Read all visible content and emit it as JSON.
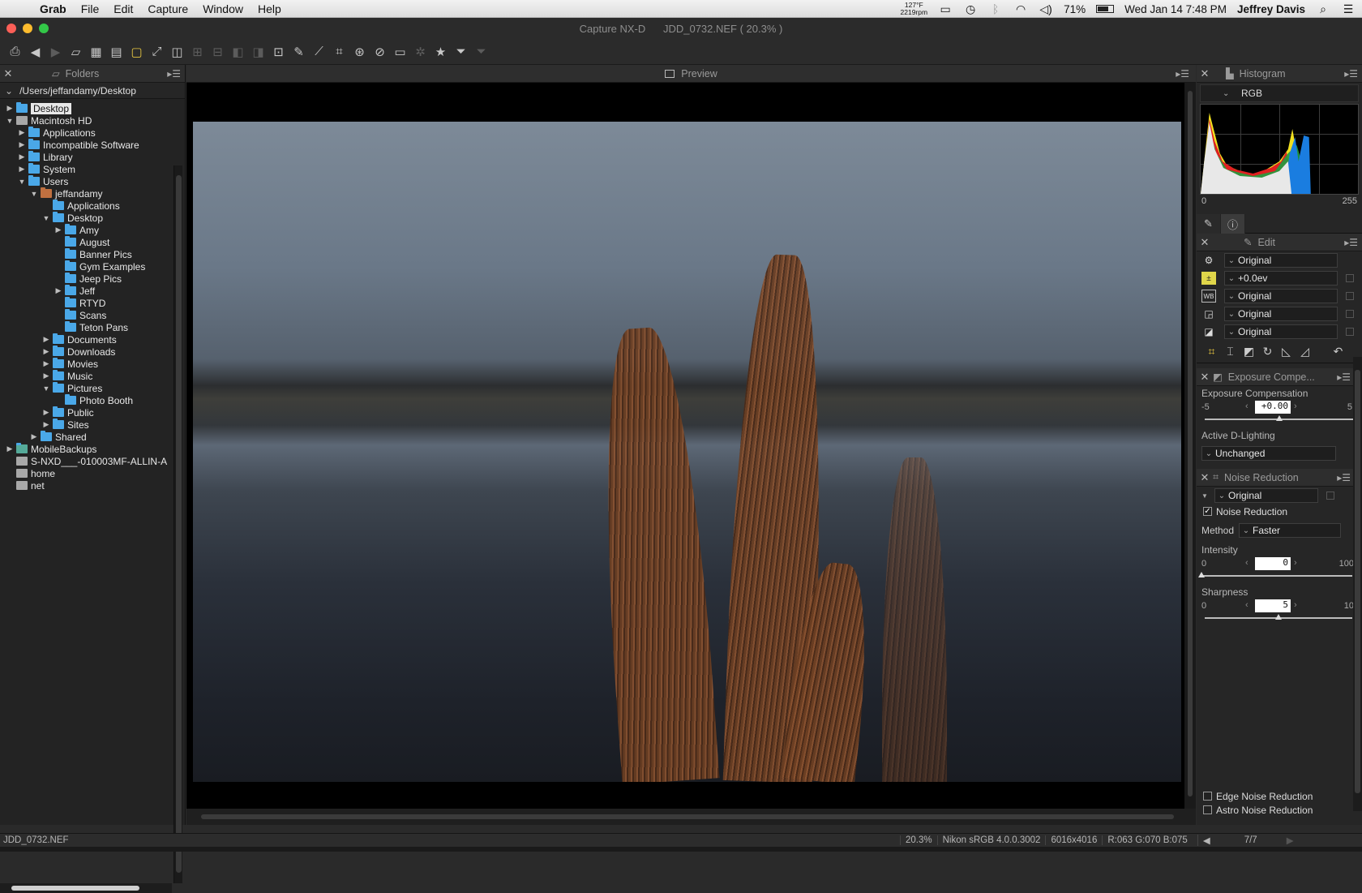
{
  "menubar": {
    "apple_icon": "apple-logo-icon",
    "app_name": "Grab",
    "items": [
      "File",
      "Edit",
      "Capture",
      "Window",
      "Help"
    ],
    "temp_line1": "127°F",
    "temp_line2": "2219rpm",
    "battery": "71%",
    "datetime": "Wed Jan 14  7:48 PM",
    "user": "Jeffrey Davis"
  },
  "window": {
    "app_title": "Capture NX-D",
    "file_title": "JDD_0732.NEF ( 20.3% )"
  },
  "folders_panel": {
    "title": "Folders",
    "path": "/Users/jeffandamy/Desktop",
    "tree": [
      {
        "label": "Desktop",
        "depth": 0,
        "tri": "▶",
        "kind": "folder",
        "selected": true
      },
      {
        "label": "Macintosh HD",
        "depth": 0,
        "tri": "▼",
        "kind": "disk"
      },
      {
        "label": "Applications",
        "depth": 1,
        "tri": "▶",
        "kind": "folder"
      },
      {
        "label": "Incompatible Software",
        "depth": 1,
        "tri": "▶",
        "kind": "folder"
      },
      {
        "label": "Library",
        "depth": 1,
        "tri": "▶",
        "kind": "folder"
      },
      {
        "label": "System",
        "depth": 1,
        "tri": "▶",
        "kind": "folder"
      },
      {
        "label": "Users",
        "depth": 1,
        "tri": "▼",
        "kind": "folder"
      },
      {
        "label": "jeffandamy",
        "depth": 2,
        "tri": "▼",
        "kind": "home"
      },
      {
        "label": "Applications",
        "depth": 3,
        "tri": "",
        "kind": "folder"
      },
      {
        "label": "Desktop",
        "depth": 3,
        "tri": "▼",
        "kind": "folder"
      },
      {
        "label": "Amy",
        "depth": 4,
        "tri": "▶",
        "kind": "folder"
      },
      {
        "label": "August",
        "depth": 4,
        "tri": "",
        "kind": "folder"
      },
      {
        "label": "Banner Pics",
        "depth": 4,
        "tri": "",
        "kind": "folder"
      },
      {
        "label": "Gym Examples",
        "depth": 4,
        "tri": "",
        "kind": "folder"
      },
      {
        "label": "Jeep Pics",
        "depth": 4,
        "tri": "",
        "kind": "folder"
      },
      {
        "label": "Jeff",
        "depth": 4,
        "tri": "▶",
        "kind": "folder"
      },
      {
        "label": "RTYD",
        "depth": 4,
        "tri": "",
        "kind": "folder"
      },
      {
        "label": "Scans",
        "depth": 4,
        "tri": "",
        "kind": "folder"
      },
      {
        "label": "Teton Pans",
        "depth": 4,
        "tri": "",
        "kind": "folder"
      },
      {
        "label": "Documents",
        "depth": 3,
        "tri": "▶",
        "kind": "folder"
      },
      {
        "label": "Downloads",
        "depth": 3,
        "tri": "▶",
        "kind": "folder"
      },
      {
        "label": "Movies",
        "depth": 3,
        "tri": "▶",
        "kind": "folder"
      },
      {
        "label": "Music",
        "depth": 3,
        "tri": "▶",
        "kind": "folder"
      },
      {
        "label": "Pictures",
        "depth": 3,
        "tri": "▼",
        "kind": "folder"
      },
      {
        "label": "Photo Booth",
        "depth": 4,
        "tri": "",
        "kind": "folder"
      },
      {
        "label": "Public",
        "depth": 3,
        "tri": "▶",
        "kind": "folder"
      },
      {
        "label": "Sites",
        "depth": 3,
        "tri": "▶",
        "kind": "folder"
      },
      {
        "label": "Shared",
        "depth": 2,
        "tri": "▶",
        "kind": "folder"
      },
      {
        "label": "MobileBackups",
        "depth": 0,
        "tri": "▶",
        "kind": "mb"
      },
      {
        "label": "S-NXD___-010003MF-ALLIN-A",
        "depth": 0,
        "tri": "",
        "kind": "disk"
      },
      {
        "label": "home",
        "depth": 0,
        "tri": "",
        "kind": "disk"
      },
      {
        "label": "net",
        "depth": 0,
        "tri": "",
        "kind": "disk"
      }
    ]
  },
  "preview_panel": {
    "title": "Preview"
  },
  "histogram_panel": {
    "title": "Histogram",
    "channel": "RGB",
    "min_label": "0",
    "max_label": "255"
  },
  "edit_panel": {
    "title": "Edit",
    "rows": [
      {
        "icon": "gear-icon",
        "value": "Original"
      },
      {
        "icon": "exposure-icon",
        "value": "+0.0ev"
      },
      {
        "icon": "white-balance-icon",
        "value": "Original"
      },
      {
        "icon": "picture-control-icon",
        "value": "Original"
      },
      {
        "icon": "tone-icon",
        "value": "Original"
      }
    ]
  },
  "exposure_panel": {
    "title": "Exposure Compe...",
    "label": "Exposure Compensation",
    "min": "-5",
    "max": "5",
    "value": "+0.00",
    "position_fraction": 0.5,
    "adl_label": "Active D-Lighting",
    "adl_value": "Unchanged"
  },
  "noise_panel": {
    "title": "Noise Reduction",
    "preset": "Original",
    "checkbox_label": "Noise Reduction",
    "checked": true,
    "method_label": "Method",
    "method_value": "Faster",
    "intensity_label": "Intensity",
    "intensity_min": "0",
    "intensity_max": "100",
    "intensity_value": "0",
    "intensity_fraction": 0.0,
    "sharpness_label": "Sharpness",
    "sharpness_min": "0",
    "sharpness_max": "10",
    "sharpness_value": "5",
    "sharpness_fraction": 0.5,
    "edge_label": "Edge Noise Reduction",
    "astro_label": "Astro Noise Reduction"
  },
  "statusbar": {
    "filename": "JDD_0732.NEF",
    "zoom": "20.3%",
    "profile": "Nikon sRGB 4.0.0.3002",
    "dimensions": "6016x4016",
    "rgb": "R:063 G:070 B:075",
    "page": "7/7"
  }
}
